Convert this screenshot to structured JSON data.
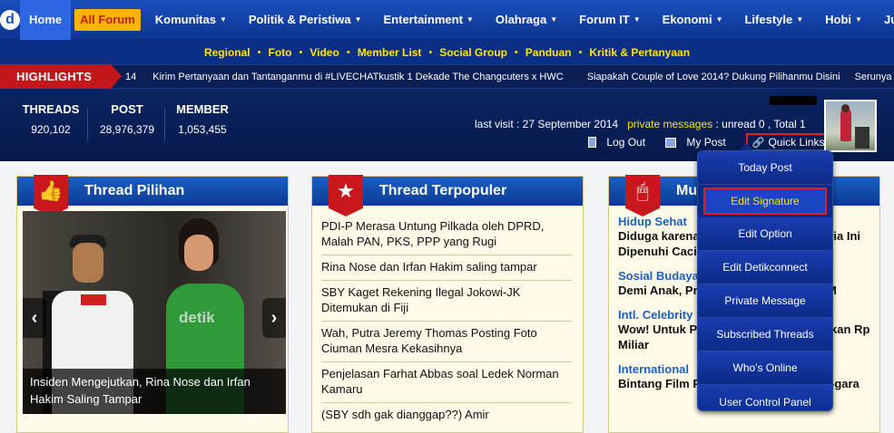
{
  "nav": {
    "items": [
      {
        "label": "Home"
      },
      {
        "label": "All Forum"
      },
      {
        "label": "Komunitas"
      },
      {
        "label": "Politik & Peristiwa"
      },
      {
        "label": "Entertainment"
      },
      {
        "label": "Olahraga"
      },
      {
        "label": "Forum IT"
      },
      {
        "label": "Ekonomi"
      },
      {
        "label": "Lifestyle"
      },
      {
        "label": "Hobi"
      },
      {
        "label": "Jual Beli"
      }
    ]
  },
  "subnav": {
    "items": [
      "Regional",
      "Foto",
      "Video",
      "Member List",
      "Social Group",
      "Panduan",
      "Kritik & Pertanyaan"
    ]
  },
  "highlights": {
    "label": "HIGHLIGHTS",
    "items": [
      "14",
      "Kirim Pertanyaan dan Tantanganmu di #LIVECHATkustik 1 Dekade The Changcuters x HWC",
      "Siapakah Couple of Love 2014? Dukung Pilihanmu Disini",
      "Serunya"
    ]
  },
  "stats": {
    "threads": {
      "label": "THREADS",
      "value": "920,102"
    },
    "post": {
      "label": "POST",
      "value": "28,976,379"
    },
    "member": {
      "label": "MEMBER",
      "value": "1,053,455"
    }
  },
  "user": {
    "last_visit": "last visit : 27 September 2014",
    "pm_label": "private messages",
    "pm_counts": ": unread 0 , Total 1",
    "logout": "Log Out",
    "mypost": "My Post",
    "quicklinks": "Quick Links"
  },
  "quick_links_menu": {
    "items": [
      "Today Post",
      "Edit Signature",
      "Edit Option",
      "Edit Detikconnect",
      "Private Message",
      "Subscribed Threads",
      "Who's Online",
      "User Control Panel"
    ],
    "selected": "Edit Signature"
  },
  "thread_pilihan": {
    "title": "Thread Pilihan",
    "caption": "Insiden Mengejutkan, Rina Nose dan Irfan Hakim Saling Tampar",
    "watermark": "detik"
  },
  "thread_terpopuler": {
    "title": "Thread Terpopuler",
    "items": [
      "PDI-P Merasa Untung Pilkada oleh DPRD, Malah PAN, PKS, PPP yang Rugi",
      "Rina Nose dan Irfan Hakim saling tampar",
      "SBY Kaget Rekening Ilegal Jokowi-JK Ditemukan di Fiji",
      "Wah, Putra Jeremy Thomas Posting Foto Ciuman Mesra Kekasihnya",
      "Penjelasan Farhat Abbas soal Ledek Norman Kamaru",
      "(SBY sdh gak dianggap??) Amir"
    ]
  },
  "third_panel": {
    "title": "Mu",
    "items": [
      {
        "category": "Hidup Sehat",
        "title": "Diduga karena Sering Makan Tubuh Pria Ini Dipenuhi Cacing"
      },
      {
        "category": "Sosial Budaya",
        "title": "Demi Anak, Pria Ini Rela Gaji Rp 99,2 M"
      },
      {
        "category": "Intl. Celebrity",
        "title": "Wow! Untuk Perawatan Artis Ini Habiskan Rp Miliar"
      },
      {
        "category": "International",
        "title": "Bintang Film Porno Ini Menuntut Gara-gara"
      }
    ]
  }
}
